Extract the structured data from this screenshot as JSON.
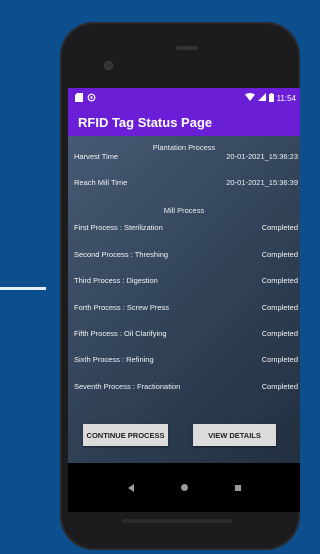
{
  "status_bar": {
    "time": "11:54"
  },
  "app_bar": {
    "title": "RFID Tag Status Page"
  },
  "plantation": {
    "title": "Plantation Process",
    "rows": [
      {
        "label": "Harvest Time",
        "value": "20-01-2021_15:36:23"
      },
      {
        "label": "Reach Mill Time",
        "value": "20-01-2021_15:36:39"
      }
    ]
  },
  "mill": {
    "title": "Mill Process",
    "rows": [
      {
        "label": "First Process : Sterilization",
        "value": "Completed"
      },
      {
        "label": "Second Process : Threshing",
        "value": "Completed"
      },
      {
        "label": "Third Process : Digestion",
        "value": "Completed"
      },
      {
        "label": "Forth Process : Screw Press",
        "value": "Completed"
      },
      {
        "label": "Fifth Process : Oil Clarifying",
        "value": "Completed"
      },
      {
        "label": "Sixth Process : Refining",
        "value": "Completed"
      },
      {
        "label": "Seventh Process : Fractionation",
        "value": "Completed"
      }
    ]
  },
  "buttons": {
    "continue": "CONTINUE PROCESS",
    "details": "VIEW DETAILS"
  },
  "colors": {
    "accent": "#6a1ed6",
    "background": "#0d4f8c"
  },
  "icons": [
    "sd-card-icon",
    "sync-icon",
    "wifi-icon",
    "signal-icon",
    "battery-icon",
    "back-icon",
    "home-icon",
    "recents-icon"
  ]
}
